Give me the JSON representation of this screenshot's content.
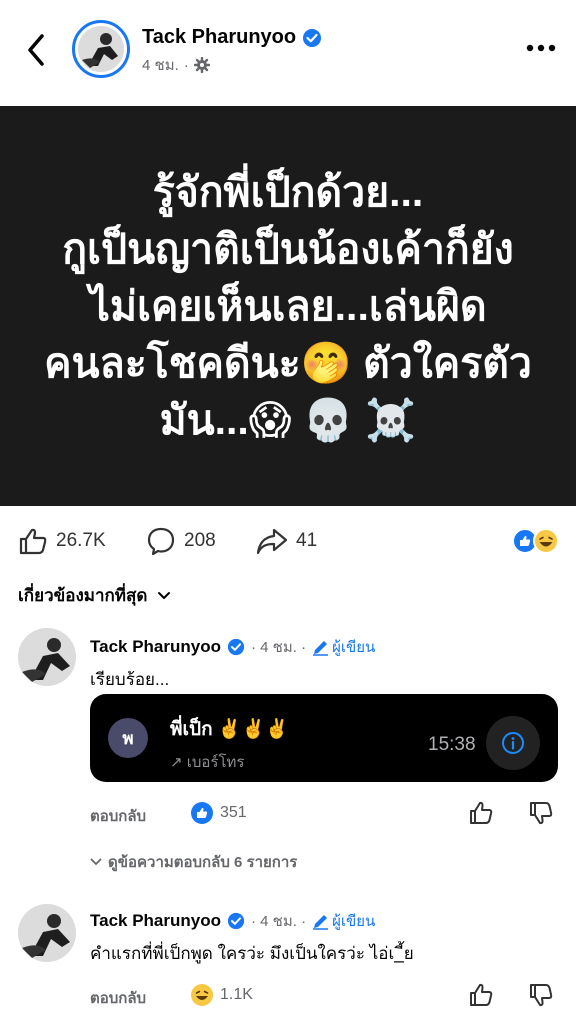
{
  "header": {
    "page_name": "Tack Pharunyoo",
    "time": "4 ชม.",
    "separator": "·"
  },
  "post": {
    "text": "รู้จักพี่เป็กด้วย...\nกูเป็นญาติเป็นน้องเค้าก็ยัง\nไม่เคยเห็นเลย...เล่นผิด\nคนละโชคดีนะ🤭 ตัวใครตัว\nมัน...😱 💀 ☠️"
  },
  "actions": {
    "likes": "26.7K",
    "comments": "208",
    "shares": "41"
  },
  "filter": {
    "label": "เกี่ยวข้องมากที่สุด"
  },
  "comments": [
    {
      "name": "Tack Pharunyoo",
      "time": "· 4 ชม. ·",
      "author_label": "ผู้เขียน",
      "text": "เรียบร้อย...",
      "reply_label": "ตอบกลับ",
      "reaction_count": "351",
      "reaction_emoji": "👍"
    },
    {
      "name": "Tack Pharunyoo",
      "time": "· 4 ชม. ·",
      "author_label": "ผู้เขียน",
      "text": "คำแรกที่พี่เป็กพูด ใครว่ะ มึงเป็นใครว่ะ ไอ่เ_ี้ย",
      "reply_label": "ตอบกลับ",
      "reaction_count": "1.1K",
      "reaction_emoji": "😆"
    }
  ],
  "call_card": {
    "avatar_letter": "พ",
    "name": "พี่เป็ก ✌️✌️✌️",
    "subtitle": "↗ เบอร์โทร",
    "time": "15:38"
  },
  "view_replies": "ดูข้อความตอบกลับ 6 รายการ",
  "reacts": [
    "👍",
    "😆"
  ],
  "colors": {
    "brand": "#1877f2",
    "post_bg": "#1b1b1b",
    "muted": "#65676b"
  }
}
